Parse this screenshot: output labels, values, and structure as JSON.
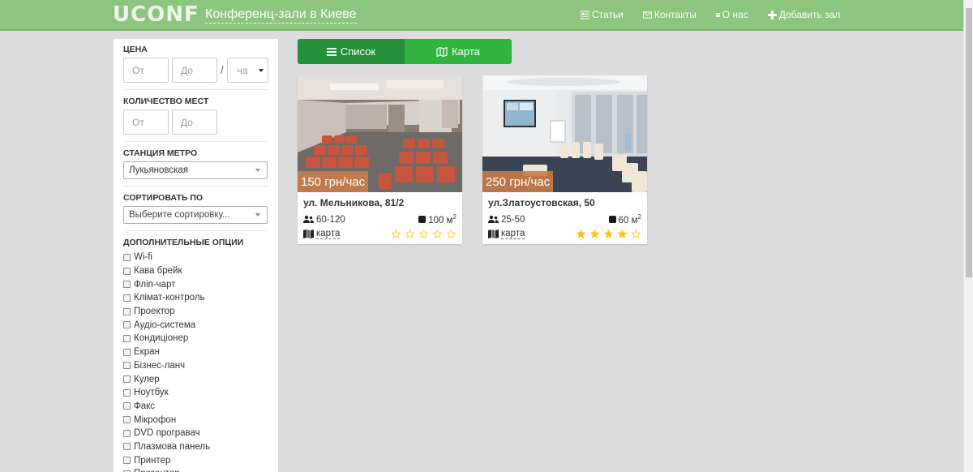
{
  "header": {
    "logo": "UCONF",
    "site_title": "Конференц-зали в Киеве",
    "nav": [
      {
        "label": "Статьи",
        "icon": "article-icon"
      },
      {
        "label": "Контакты",
        "icon": "envelope-icon"
      },
      {
        "label": "О нас",
        "icon": "info-icon"
      },
      {
        "label": "Добавить зал",
        "icon": "plus-icon"
      }
    ]
  },
  "filters": {
    "price": {
      "title": "ЦЕНА",
      "from_placeholder": "От",
      "to_placeholder": "До",
      "separator": "/",
      "unit_value": "ча"
    },
    "seats": {
      "title": "КОЛИЧЕСТВО МЕСТ",
      "from_placeholder": "От",
      "to_placeholder": "До"
    },
    "metro": {
      "title": "СТАНЦИЯ МЕТРО",
      "value": "Лукьяновская"
    },
    "sort": {
      "title": "СОРТИРОВАТЬ ПО",
      "value": "Выберите сортировку..."
    },
    "options": {
      "title": "ДОПОЛНИТЕЛЬНЫЕ ОПЦИИ",
      "items": [
        "Wi-fi",
        "Кава брейк",
        "Фліп-чарт",
        "Клімат-контроль",
        "Проектор",
        "Аудіо-система",
        "Кондиціонер",
        "Екран",
        "Бізнес-ланч",
        "Кулер",
        "Ноутбук",
        "Факс",
        "Мікрофон",
        "DVD програвач",
        "Плазмова панель",
        "Принтер",
        "Презентер"
      ]
    }
  },
  "view_toggle": {
    "list_label": "Список",
    "map_label": "Карта"
  },
  "cards": [
    {
      "price": "150 грн/час",
      "address": "ул. Мельникова, 81/2",
      "capacity": "60-120",
      "area": "100 м",
      "area_sup": "2",
      "map_label": "карта",
      "rating": 0,
      "rating_max": 5
    },
    {
      "price": "250 грн/час",
      "address": "ул.Златоустовская, 50",
      "capacity": "25-50",
      "area": "60 м",
      "area_sup": "2",
      "map_label": "карта",
      "rating": 4,
      "rating_max": 5
    }
  ],
  "colors": {
    "header_bg": "#8cc57e",
    "list_btn": "#26903a",
    "map_btn": "#2eb43f",
    "star_filled": "#f5c518",
    "star_empty": "#f5c518"
  }
}
